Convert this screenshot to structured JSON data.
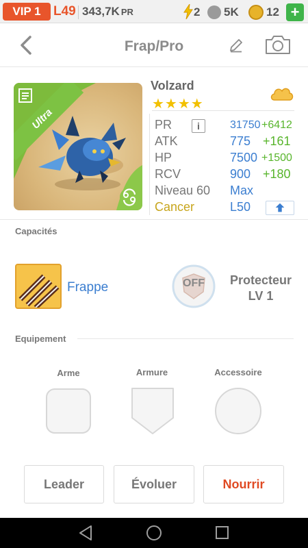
{
  "status_bar": {
    "vip": "VIP 1",
    "level": "L49",
    "pr_value": "343,7K",
    "pr_unit": "PR",
    "energy": "2",
    "food": "5K",
    "gems": "12",
    "plus_label": "+"
  },
  "header": {
    "title": "Frap/Pro",
    "back_icon": "chevron-left-icon",
    "edit_icon": "pencil-icon",
    "camera_icon": "camera-icon"
  },
  "monster": {
    "name": "Volzard",
    "rarity_badge": "Ultra",
    "stars": "★★★★",
    "stats": {
      "pr_label": "PR",
      "pr_value": "31750",
      "pr_bonus": "+6412",
      "atk_label": "ATK",
      "atk_value": "775",
      "atk_bonus": "+161",
      "hp_label": "HP",
      "hp_value": "7500",
      "hp_bonus": "+1500",
      "rcv_label": "RCV",
      "rcv_value": "900",
      "rcv_bonus": "+180",
      "level_label": "Niveau 60",
      "level_value": "Max",
      "sign_label": "Cancer",
      "sign_value": "L50"
    },
    "info_label": "i",
    "element_color": "#3b7ed0",
    "bonus_color": "#58b52c"
  },
  "capacities": {
    "section_title": "Capacités",
    "skill_name": "Frappe",
    "passive_badge": "OFF",
    "passive_name": "Protecteur",
    "passive_level": "LV 1"
  },
  "equipment": {
    "section_title": "Equipement",
    "weapon_label": "Arme",
    "armor_label": "Armure",
    "accessory_label": "Accessoire"
  },
  "actions": {
    "leader": "Leader",
    "evolve": "Évoluer",
    "feed": "Nourrir",
    "accent_color": "#e04a23"
  }
}
